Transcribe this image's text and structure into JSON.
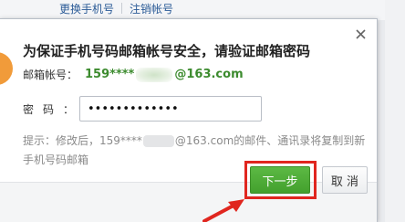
{
  "background": {
    "links": [
      "更换手机号",
      "注销帐号"
    ]
  },
  "dialog": {
    "title": "为保证手机号码邮箱帐号安全，请验证邮箱密码",
    "email_label": "邮箱帐号：",
    "email_prefix": "159****",
    "email_suffix": "@163.com",
    "password_label": "密码：",
    "password_value": "•••••••••••••",
    "tip_prefix": "提示：修改后，159****",
    "tip_suffix": "@163.com的邮件、通讯录将复制到新手机号码邮箱",
    "next_button": "下一步",
    "cancel_button": "取 消"
  },
  "colors": {
    "accent_green": "#43a02d",
    "highlight_red": "#e0261f",
    "email_green": "#3c8b2e"
  },
  "icons": {
    "close": "close-icon",
    "annotation": "arrow-icon"
  }
}
